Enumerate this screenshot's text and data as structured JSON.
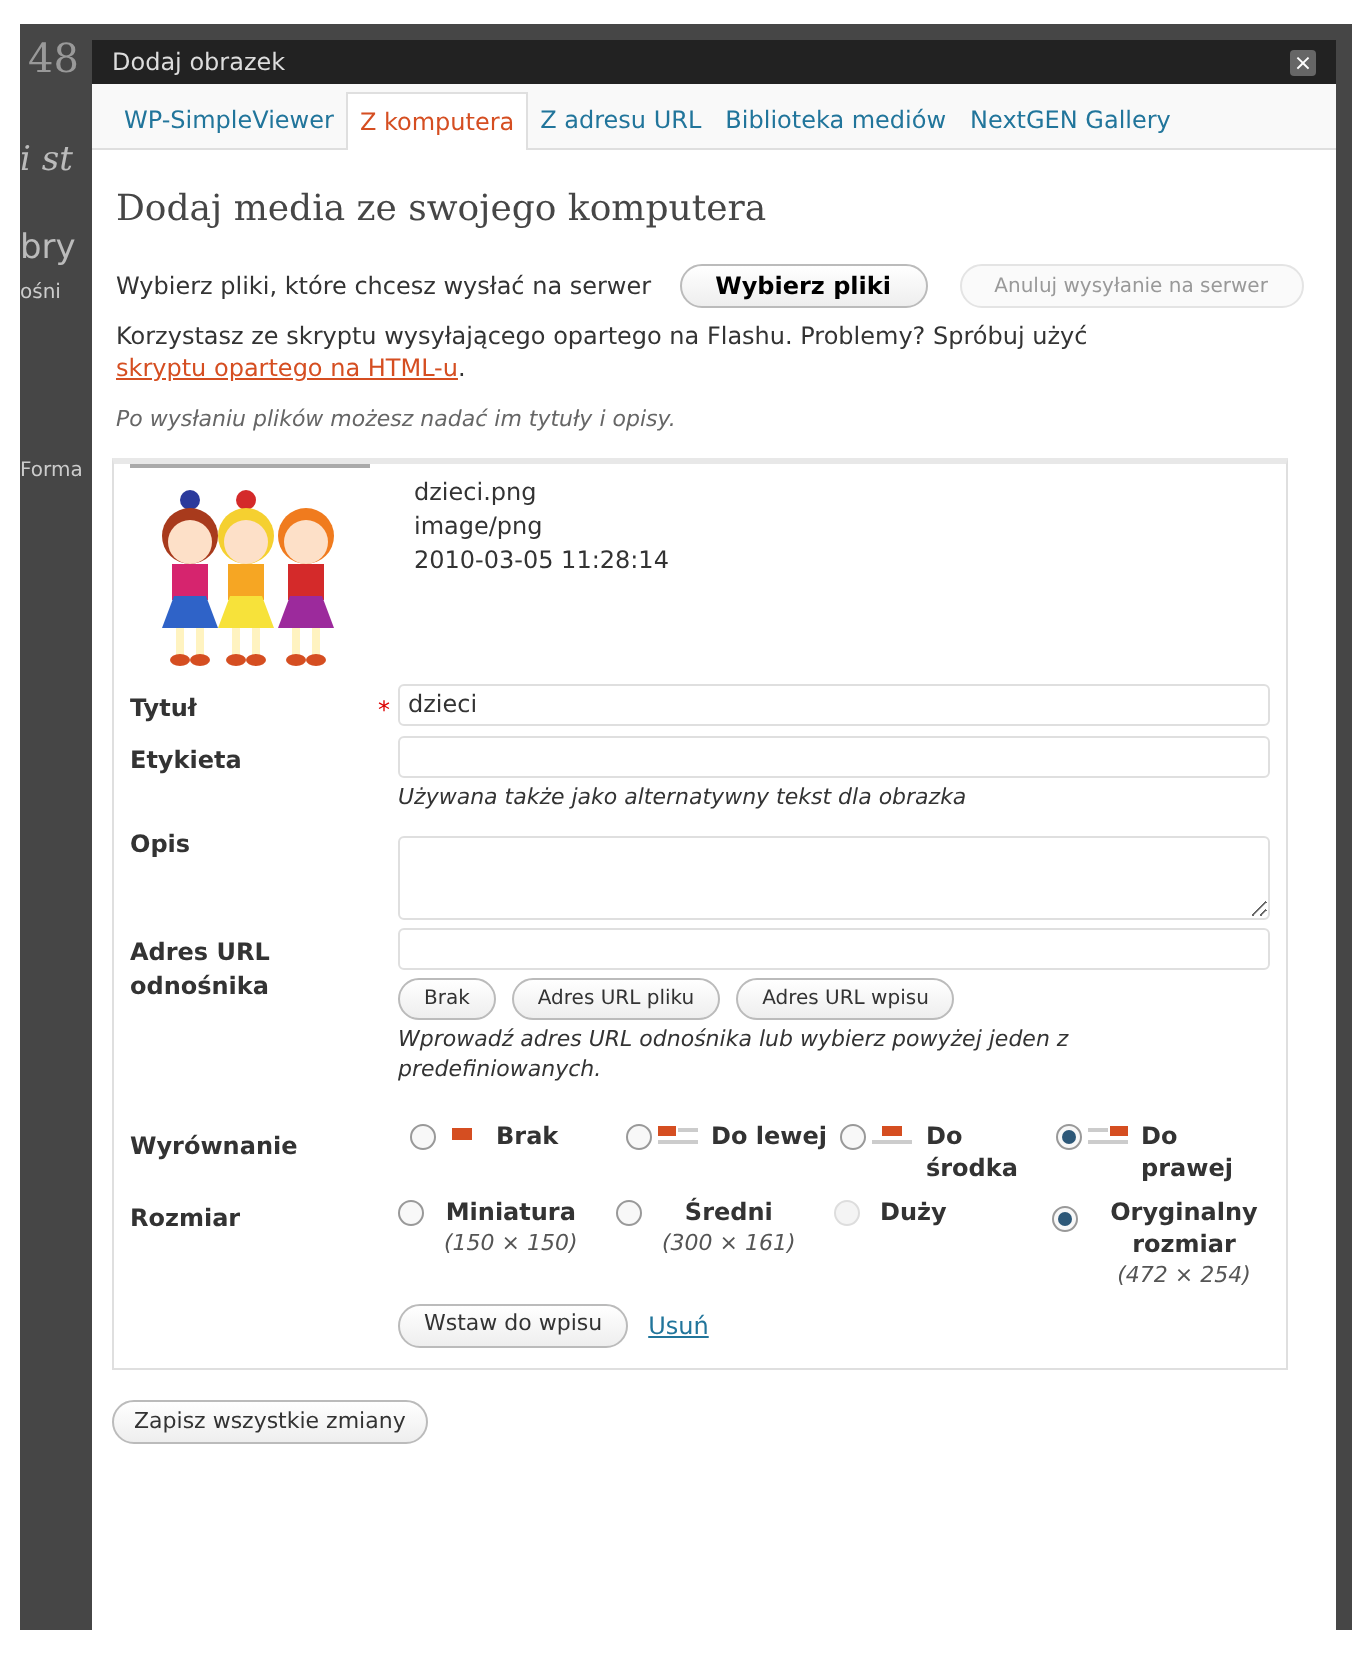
{
  "background_fragments": [
    "48",
    "i st",
    "bry",
    "ośni",
    "Forma"
  ],
  "window": {
    "title": "Dodaj obrazek",
    "close": "×"
  },
  "tabs": [
    {
      "label": "WP-SimpleViewer",
      "selected": false
    },
    {
      "label": "Z komputera",
      "selected": true
    },
    {
      "label": "Z adresu URL",
      "selected": false
    },
    {
      "label": "Biblioteka mediów",
      "selected": false
    },
    {
      "label": "NextGEN Gallery",
      "selected": false
    }
  ],
  "heading": "Dodaj media ze swojego komputera",
  "upload": {
    "label": "Wybierz pliki, które chcesz wysłać na serwer",
    "choose_button": "Wybierz pliki",
    "cancel_button": {
      "label": "Anuluj wysyłanie na serwer",
      "disabled": true
    }
  },
  "flash_note": {
    "text": "Korzystasz ze skryptu wysyłającego opartego na Flashu. Problemy? Spróbuj użyć",
    "link": "skryptu opartego na HTML-u",
    "after": "."
  },
  "hint": "Po wysłaniu plików możesz nadać im tytuły i opisy.",
  "file": {
    "kind": "picture",
    "name": "dzieci.png",
    "type": "image/png",
    "date": "2010-03-05 11:28:14"
  },
  "required_mark": "*",
  "fields": [
    {
      "label": "Tytuł",
      "required": true,
      "value": "dzieci",
      "kind": "input"
    },
    {
      "label": "Etykieta",
      "required": false,
      "kind": "input",
      "help": "Używana także jako alternatywny tekst dla obrazka"
    },
    {
      "label": "Opis",
      "required": false,
      "kind": "textarea"
    },
    {
      "label": "Adres URL odnośnika",
      "required": false,
      "kind": "url",
      "buttons": [
        "Brak",
        "Adres URL pliku",
        "Adres URL wpisu"
      ],
      "help": "Wprowadź adres URL odnośnika lub wybierz powyżej jeden z predefiniowanych."
    }
  ],
  "alignment": {
    "label": "Wyrównanie",
    "options": [
      {
        "label": "Brak",
        "selected": false
      },
      {
        "label": "Do lewej",
        "selected": false
      },
      {
        "label": "Do środka",
        "selected": false
      },
      {
        "label": "Do prawej",
        "selected": true
      }
    ]
  },
  "size": {
    "label": "Rozmiar",
    "options": [
      {
        "label": "Miniatura",
        "dims": "(150 × 150)",
        "selected": false,
        "disabled": false
      },
      {
        "label": "Średni",
        "dims": "(300 × 161)",
        "selected": false,
        "disabled": false
      },
      {
        "label": "Duży",
        "selected": false,
        "disabled": true
      },
      {
        "label": "Oryginalny rozmiar",
        "dims": "(472 × 254)",
        "selected": true,
        "disabled": false
      }
    ]
  },
  "insert_button": "Wstaw do wpisu",
  "delete_link": "Usuń",
  "save_button": "Zapisz wszystkie zmiany"
}
